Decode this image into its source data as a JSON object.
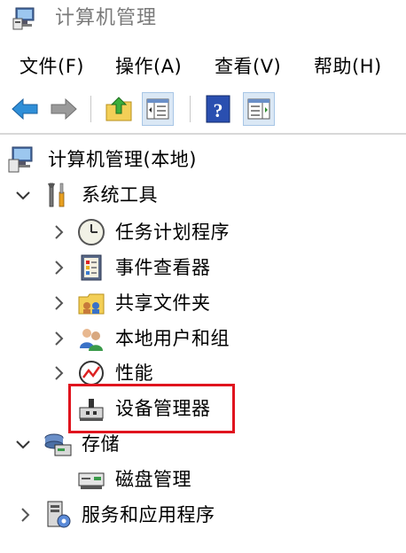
{
  "window": {
    "title": "计算机管理"
  },
  "menu": [
    "文件(F)",
    "操作(A)",
    "查看(V)",
    "帮助(H)"
  ],
  "toolbar": {
    "icons": [
      "back-arrow-icon",
      "forward-arrow-icon",
      "up-folder-icon",
      "show-hide-tree-icon",
      "help-icon",
      "action-pane-icon"
    ]
  },
  "tree": {
    "root": "计算机管理(本地)",
    "system_tools": "系统工具",
    "task_scheduler": "任务计划程序",
    "event_viewer": "事件查看器",
    "shared_folders": "共享文件夹",
    "local_users_groups": "本地用户和组",
    "performance": "性能",
    "device_manager": "设备管理器",
    "storage": "存储",
    "disk_management": "磁盘管理",
    "services_apps": "服务和应用程序"
  },
  "colors": {
    "highlight": "#e0141e",
    "accent_blue": "#2f8fd8"
  }
}
